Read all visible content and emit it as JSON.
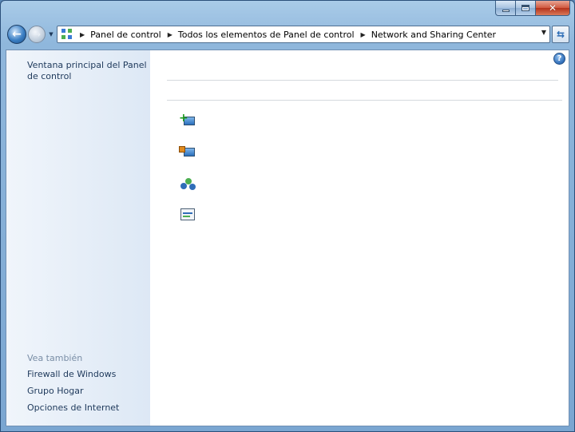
{
  "breadcrumb": {
    "items": [
      "Panel de control",
      "Todos los elementos de Panel de control",
      "Network and Sharing Center"
    ]
  },
  "sidebar": {
    "home_link": "Ventana principal del Panel de control",
    "see_also_heading": "Vea también",
    "see_also": [
      "Firewall de Windows",
      "Grupo Hogar",
      "Opciones de Internet"
    ]
  },
  "icons": {
    "back": "back-arrow-icon",
    "forward": "forward-arrow-icon",
    "help": "help-icon",
    "refresh": "refresh-icon"
  },
  "colors": {
    "link": "#1e395b",
    "heading_muted": "#7a8ea6",
    "frame": "#8fb7dc"
  }
}
